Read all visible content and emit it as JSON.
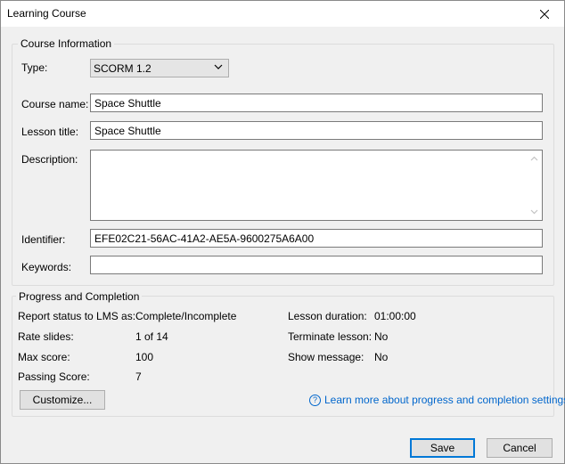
{
  "window": {
    "title": "Learning Course"
  },
  "course_info": {
    "legend": "Course Information",
    "type_label": "Type:",
    "type_value": "SCORM 1.2",
    "course_name_label": "Course name:",
    "course_name_value": "Space Shuttle",
    "lesson_title_label": "Lesson title:",
    "lesson_title_value": "Space Shuttle",
    "description_label": "Description:",
    "description_value": "",
    "identifier_label": "Identifier:",
    "identifier_value": "EFE02C21-56AC-41A2-AE5A-9600275A6A00",
    "keywords_label": "Keywords:",
    "keywords_value": ""
  },
  "progress": {
    "legend": "Progress and Completion",
    "report_status_label": "Report status to LMS as:",
    "report_status_value": "Complete/Incomplete",
    "rate_slides_label": "Rate slides:",
    "rate_slides_value": "1 of 14",
    "max_score_label": "Max score:",
    "max_score_value": "100",
    "passing_score_label": "Passing Score:",
    "passing_score_value": "7",
    "lesson_duration_label": "Lesson duration:",
    "lesson_duration_value": "01:00:00",
    "terminate_lesson_label": "Terminate lesson:",
    "terminate_lesson_value": "No",
    "show_message_label": "Show message:",
    "show_message_value": "No",
    "customize_label": "Customize...",
    "learn_more_label": "Learn more about progress and completion settings"
  },
  "footer": {
    "save_label": "Save",
    "cancel_label": "Cancel"
  }
}
